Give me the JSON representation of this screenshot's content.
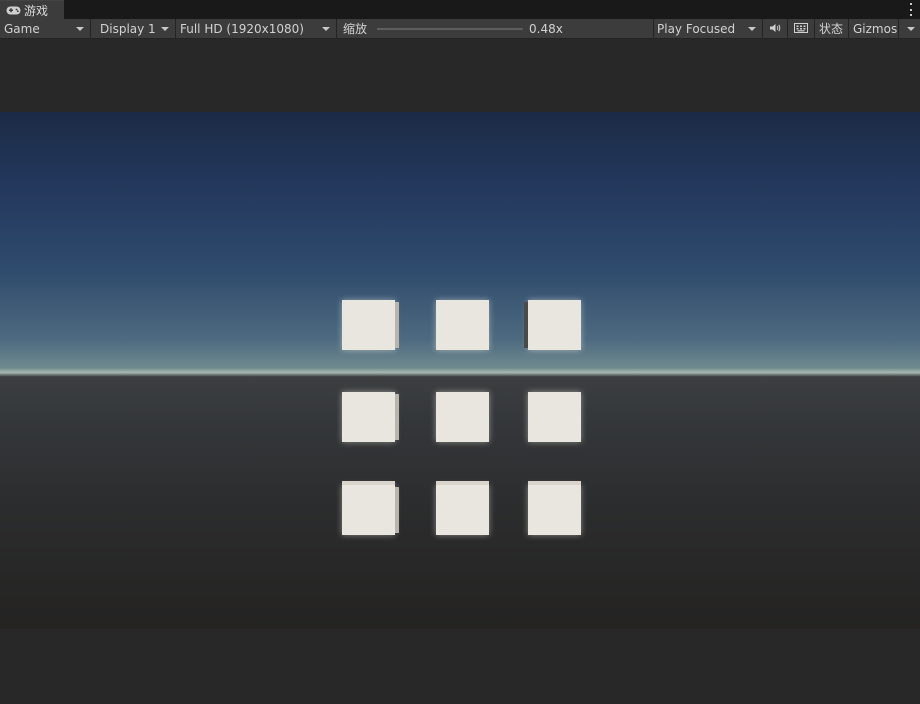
{
  "tab": {
    "label": "游戏",
    "icon": "gamepad-icon"
  },
  "toolbar": {
    "view_mode": "Game",
    "display": "Display 1",
    "resolution": "Full HD (1920x1080)",
    "scale_label": "缩放",
    "scale_value": "0.48x",
    "scale_fraction": 0.0,
    "play_mode": "Play Focused",
    "audio_icon": "speaker-icon",
    "stats_icon": "keyboard-icon",
    "stats_label": "状态",
    "gizmos_label": "Gizmos"
  },
  "scene": {
    "cubes": [
      {
        "row": 1,
        "col": 1
      },
      {
        "row": 1,
        "col": 2
      },
      {
        "row": 1,
        "col": 3
      },
      {
        "row": 2,
        "col": 1
      },
      {
        "row": 2,
        "col": 2
      },
      {
        "row": 2,
        "col": 3
      },
      {
        "row": 3,
        "col": 1
      },
      {
        "row": 3,
        "col": 2
      },
      {
        "row": 3,
        "col": 3
      }
    ]
  }
}
